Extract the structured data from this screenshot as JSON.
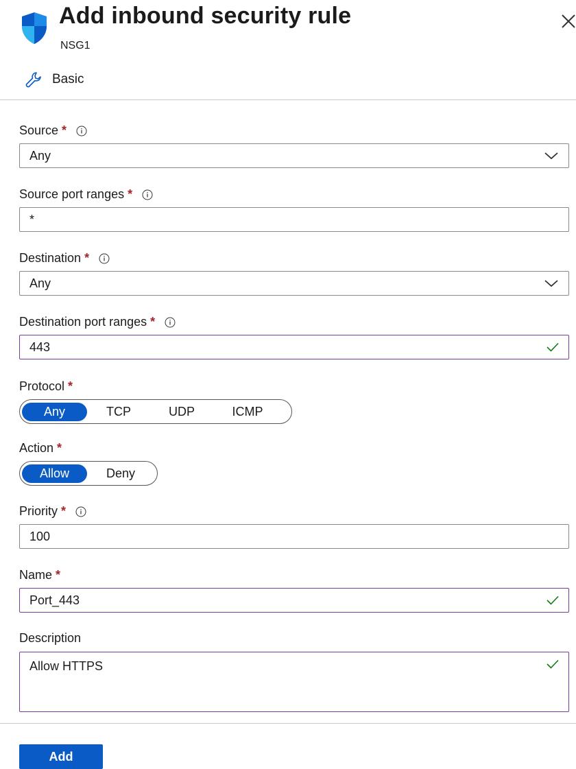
{
  "header": {
    "title": "Add inbound security rule",
    "subtitle": "NSG1"
  },
  "tabs": [
    {
      "label": "Basic",
      "icon": "wrench-icon"
    }
  ],
  "required_marker": "*",
  "fields": {
    "source": {
      "label": "Source",
      "value": "Any"
    },
    "source_port_ranges": {
      "label": "Source port ranges",
      "value": "*"
    },
    "destination": {
      "label": "Destination",
      "value": "Any"
    },
    "destination_port_ranges": {
      "label": "Destination port ranges",
      "value": "443"
    },
    "protocol": {
      "label": "Protocol",
      "options": [
        "Any",
        "TCP",
        "UDP",
        "ICMP"
      ],
      "selected": "Any"
    },
    "action": {
      "label": "Action",
      "options": [
        "Allow",
        "Deny"
      ],
      "selected": "Allow"
    },
    "priority": {
      "label": "Priority",
      "value": "100"
    },
    "name": {
      "label": "Name",
      "value": "Port_443"
    },
    "description": {
      "label": "Description",
      "value": "Allow HTTPS"
    }
  },
  "buttons": {
    "add": "Add"
  },
  "colors": {
    "accent": "#0b5bc7",
    "required": "#a4262c",
    "valid_border": "#7a3c9c",
    "check": "#107c10"
  }
}
